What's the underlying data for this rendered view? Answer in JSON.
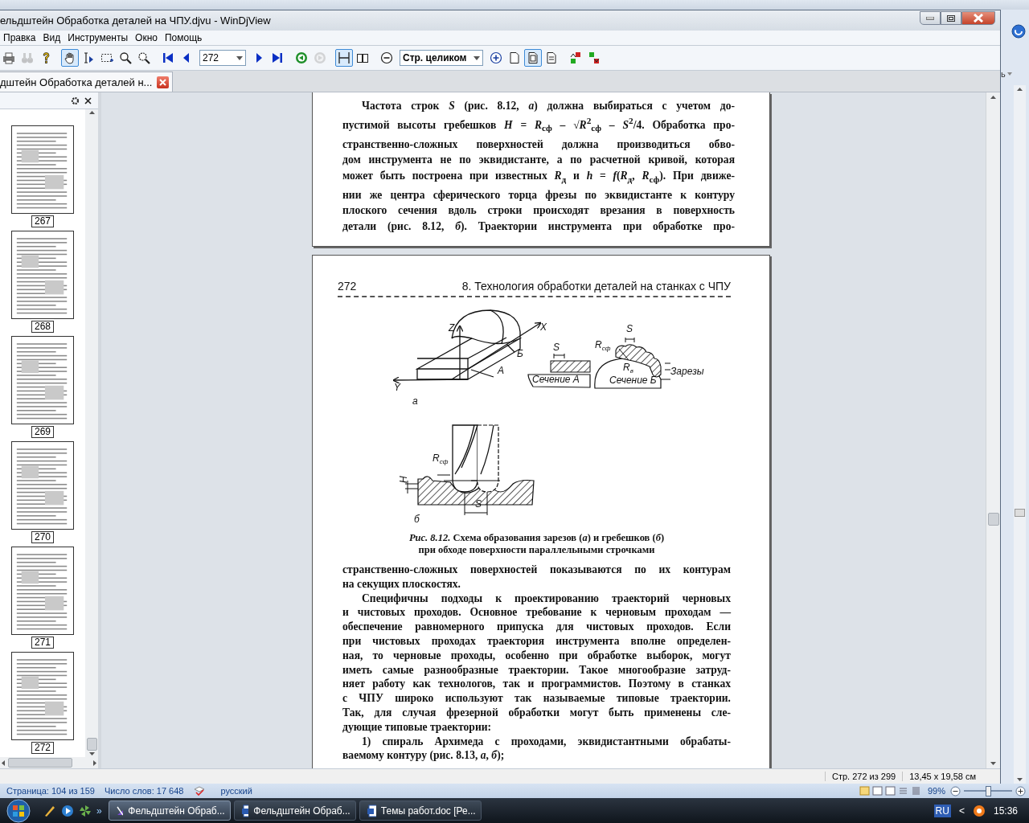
{
  "window": {
    "title": "ельдштейн Обработка деталей на ЧПУ.djvu - WinDjView"
  },
  "menu": [
    "Правка",
    "Вид",
    "Инструменты",
    "Окно",
    "Помощь"
  ],
  "toolbar": [
    {
      "kind": "print",
      "selected": false,
      "disabled": false
    },
    {
      "kind": "find",
      "selected": false,
      "disabled": true
    },
    {
      "kind": "help",
      "selected": false,
      "disabled": false
    },
    {
      "kind": "sep"
    },
    {
      "kind": "hand",
      "selected": true,
      "disabled": false
    },
    {
      "kind": "select-text",
      "selected": false,
      "disabled": false
    },
    {
      "kind": "select-rect",
      "selected": false,
      "disabled": false
    },
    {
      "kind": "zoom",
      "selected": false,
      "disabled": false
    },
    {
      "kind": "zoom-rect",
      "selected": false,
      "disabled": false
    },
    {
      "kind": "sep"
    },
    {
      "kind": "first",
      "selected": false,
      "disabled": false
    },
    {
      "kind": "prev",
      "selected": false,
      "disabled": false
    },
    {
      "kind": "page-field",
      "value": "272"
    },
    {
      "kind": "next",
      "selected": false,
      "disabled": false
    },
    {
      "kind": "last",
      "selected": false,
      "disabled": false
    },
    {
      "kind": "sep"
    },
    {
      "kind": "back",
      "selected": false,
      "disabled": false
    },
    {
      "kind": "forward",
      "selected": false,
      "disabled": true
    },
    {
      "kind": "sep"
    },
    {
      "kind": "continuous",
      "selected": true,
      "disabled": false
    },
    {
      "kind": "facing",
      "selected": false,
      "disabled": false
    },
    {
      "kind": "sep"
    },
    {
      "kind": "zoom-out",
      "selected": false,
      "disabled": false
    },
    {
      "kind": "zoom-field",
      "value": "Стр. целиком"
    },
    {
      "kind": "zoom-in",
      "selected": false,
      "disabled": false
    },
    {
      "kind": "page",
      "selected": false,
      "disabled": false
    },
    {
      "kind": "page-fit",
      "selected": true,
      "disabled": false
    },
    {
      "kind": "page-width",
      "selected": false,
      "disabled": false
    },
    {
      "kind": "sep"
    },
    {
      "kind": "rotate-left",
      "selected": false,
      "disabled": false
    },
    {
      "kind": "rotate-right",
      "selected": false,
      "disabled": false
    }
  ],
  "tabs": [
    {
      "label": "дштейн Обработка деталей н...",
      "selected": true
    }
  ],
  "thumbnails": [
    {
      "label": "267"
    },
    {
      "label": "268"
    },
    {
      "label": "269"
    },
    {
      "label": "270"
    },
    {
      "label": "271"
    },
    {
      "label": "272"
    }
  ],
  "pages": [
    {
      "kind": "text",
      "paragraphs": [
        {
          "indent": true,
          "continues": true,
          "lines": [
            "Частота строк *S* (рис. 8.12, *а*) должна выбираться с учетом до-",
            "пустимой высоты гребешков *H* = *R*$_{сф}$ – √*R*$^{2}$$_{сф}$ – *S*$^{2}$/4. Обработка про-",
            "странственно-сложных поверхностей должна производиться обво-",
            "дом инструмента не по эквидистанте, а по расчетной кривой, которая",
            "может быть построена при известных *R*$_{д}$ и *h* = *f*(*R*$_{д}$, *R*$_{сф}$). При движе-",
            "нии же центра сферического торца фрезы по эквидистанте к контуру",
            "плоского сечения вдоль строки происходят врезания в поверхность",
            "детали (рис. 8.12, *б*). Траектории инструмента при обработке про-"
          ]
        }
      ]
    },
    {
      "kind": "figure",
      "number": "272",
      "header": "8. Технология обработки деталей на станках с ЧПУ",
      "figure": {
        "labels": [
          {
            "text": "Z"
          },
          {
            "text": "X"
          },
          {
            "text": "Б"
          },
          {
            "text": "A"
          },
          {
            "text": "Y"
          },
          {
            "text": "S"
          },
          {
            "text": "Сечение А"
          },
          {
            "text": "S"
          },
          {
            "text": "R",
            "sub": "сф"
          },
          {
            "text": "R",
            "sub": "в"
          },
          {
            "text": "Сечение Б"
          },
          {
            "text": "Зарезы"
          },
          {
            "text": "а"
          },
          {
            "text": "R",
            "sub": "сф"
          },
          {
            "text": "H"
          },
          {
            "text": "S"
          },
          {
            "text": "б"
          }
        ],
        "caption": [
          "*Рис. 8.12.* Схема образования зарезов (*а*) и гребешков (*б*)",
          "при обходе поверхности параллельными строчками"
        ]
      },
      "paragraphs": [
        {
          "indent": false,
          "continues": false,
          "lines": [
            "странственно-сложных поверхностей показываются по их контурам",
            "на секущих плоскостях."
          ]
        },
        {
          "indent": true,
          "continues": false,
          "lines": [
            "Специфичны подходы к проектированию траекторий черновых",
            "и чистовых проходов. Основное требование к черновым проходам —",
            "обеспечение равномерного припуска для чистовых проходов. Если",
            "при чистовых проходах траектория инструмента вполне определен-",
            "ная, то черновые проходы, особенно при обработке выборок, могут",
            "иметь самые разнообразные траектории. Такое многообразие затруд-",
            "няет работу как технологов, так и программистов. Поэтому в станках",
            "с ЧПУ широко используют так называемые типовые траектории.",
            "Так, для случая фрезерной обработки могут быть применены сле-",
            "дующие типовые траектории:"
          ]
        },
        {
          "indent": true,
          "continues": false,
          "lines": [
            "1) спираль Архимеда с проходами, эквидистантными обрабаты-",
            "ваемому контуру (рис. 8.13, *а*, *б*);"
          ]
        }
      ]
    }
  ],
  "status_bar": [
    "Стр. 272 из 299",
    "13,45 x 19,58 см"
  ],
  "word_side": {
    "text": "ь"
  },
  "word_status": {
    "page": "Страница: 104 из 159",
    "words": "Число слов: 17 648",
    "language": "русский",
    "zoom": "99%",
    "level": 0.5
  },
  "taskbar": {
    "tasks": [
      {
        "label": "Фельдштейн Обраб...",
        "kind": "djvu",
        "selected": true
      },
      {
        "label": "Фельдштейн Обраб...",
        "kind": "word",
        "selected": false
      },
      {
        "label": "Темы работ.doc [Ре...",
        "kind": "word",
        "selected": false
      }
    ],
    "more": "»",
    "language": "RU",
    "tray_arrow": "<",
    "clock": "15:36"
  }
}
